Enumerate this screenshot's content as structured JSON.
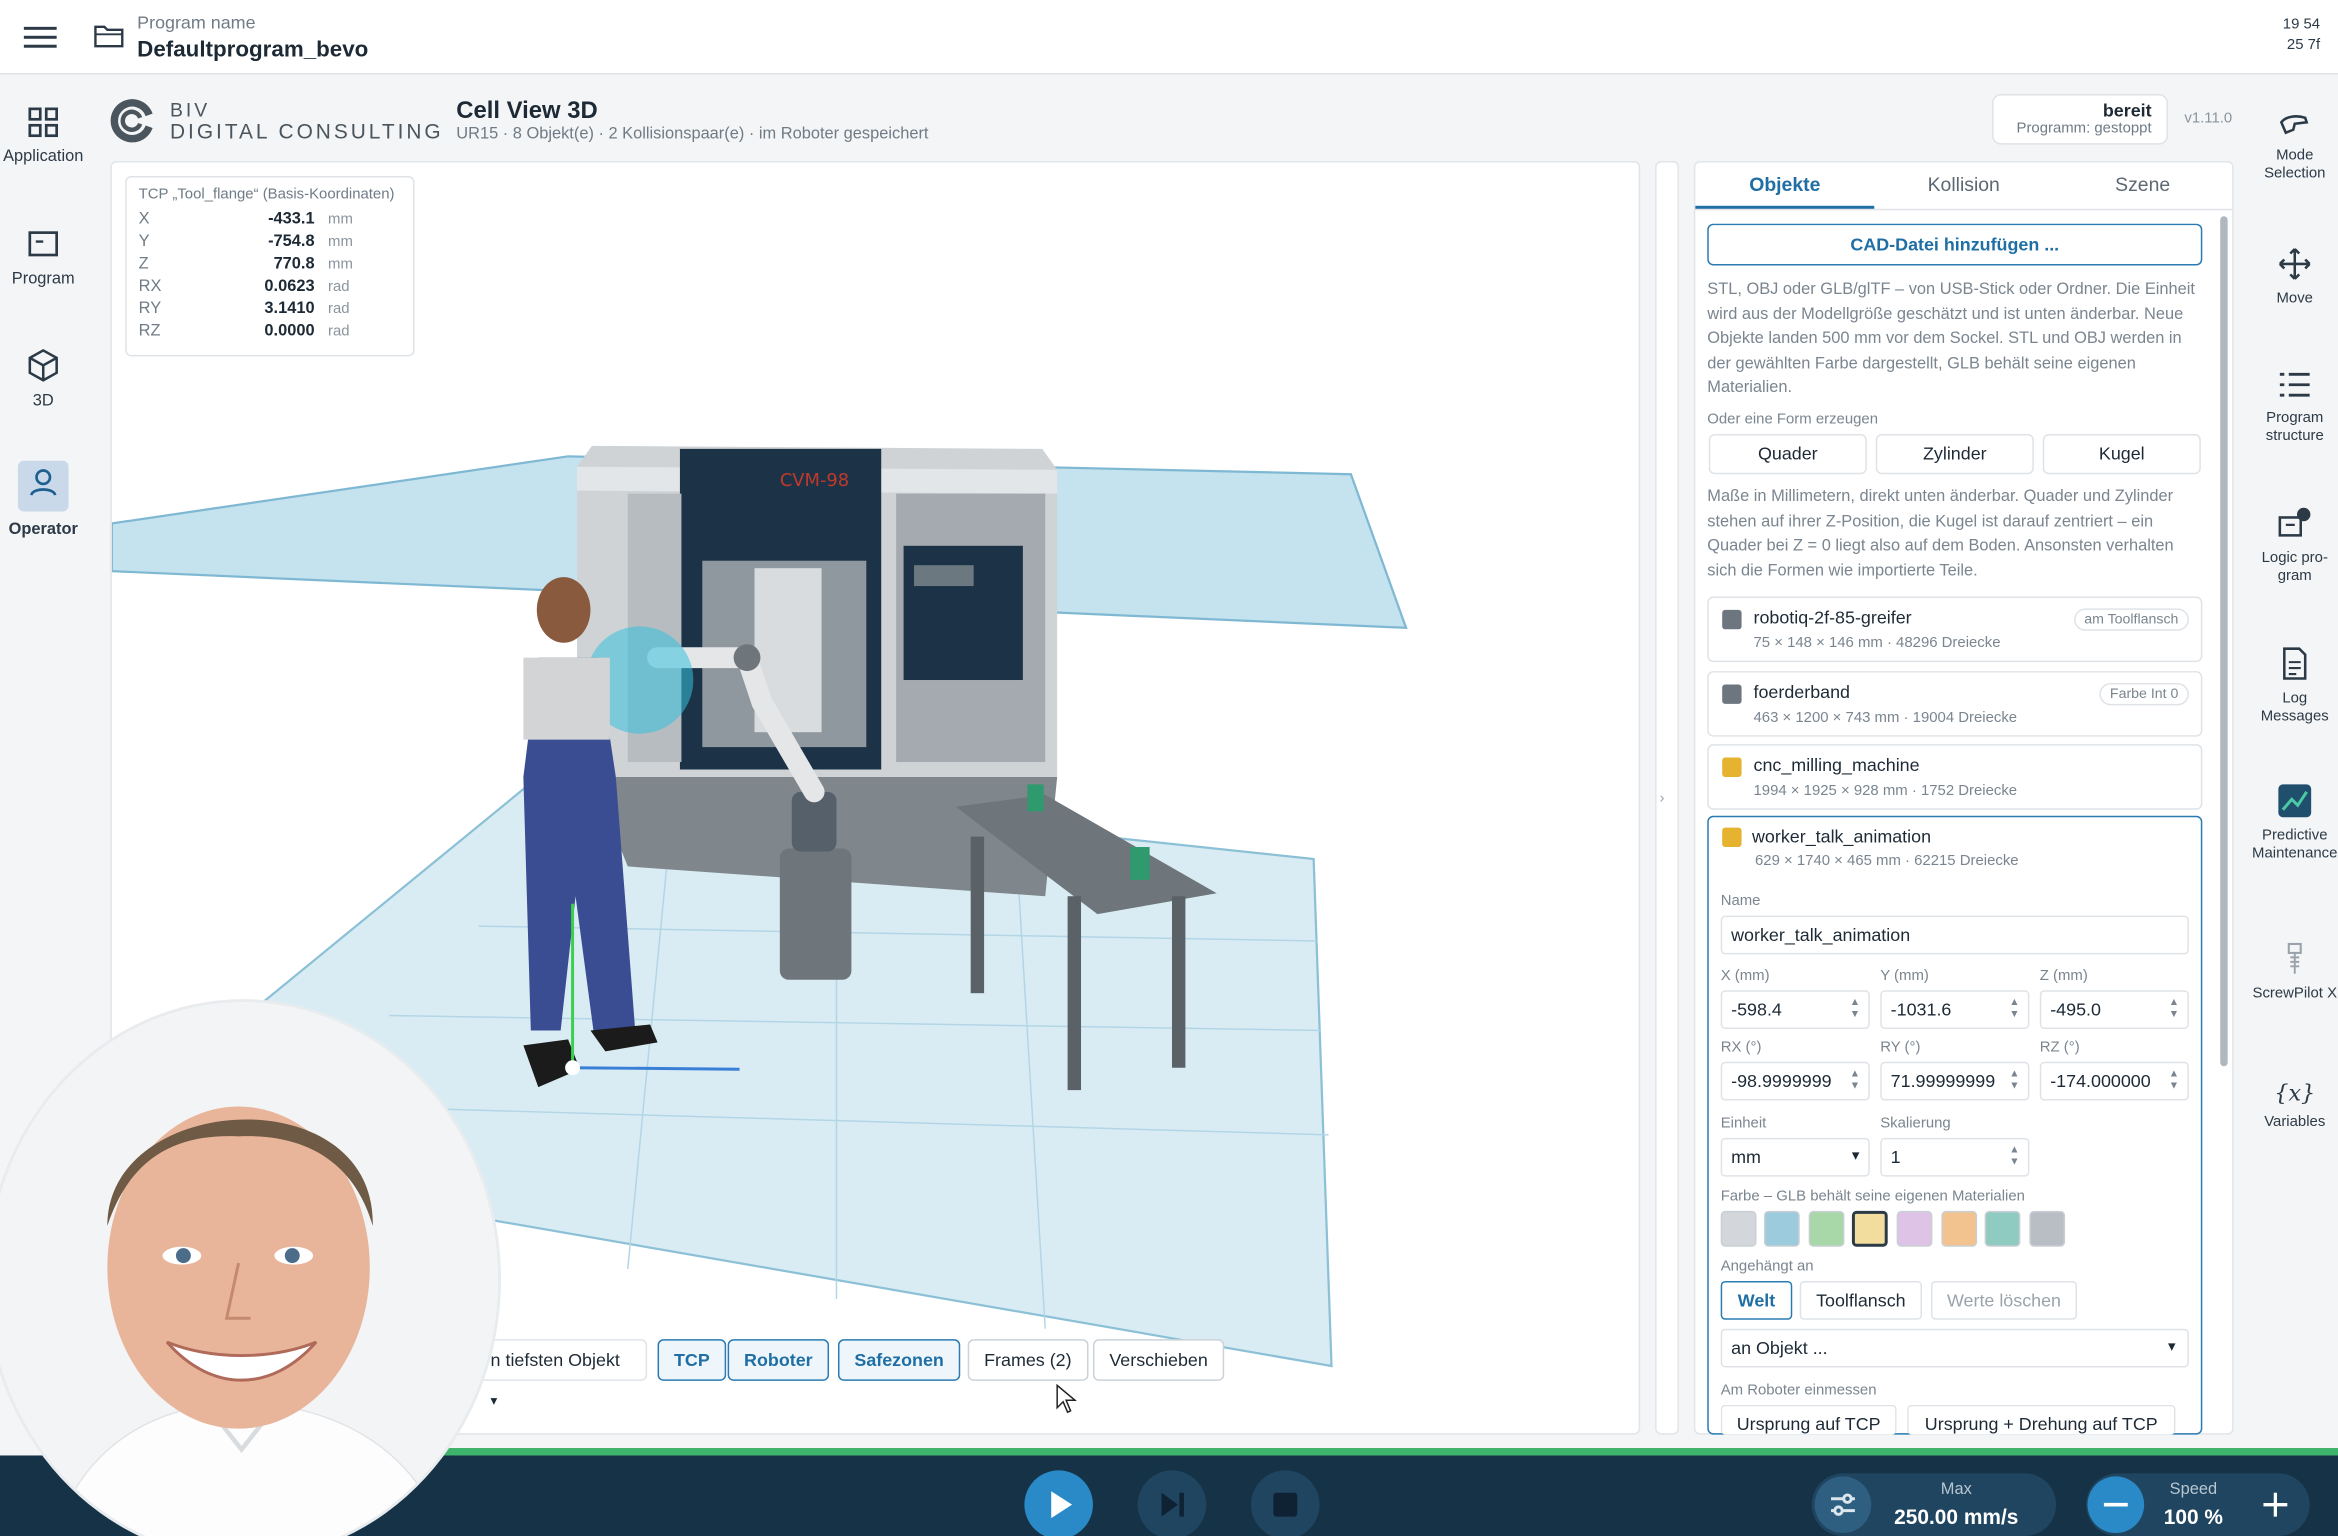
{
  "topbar": {
    "program_label": "Program name",
    "program_name": "Defaultprogram_bevo",
    "clock_line1": "19 54",
    "clock_line2": "25 7f"
  },
  "leftnav": {
    "items": [
      {
        "label": "Application",
        "icon": "grid-icon"
      },
      {
        "label": "Program",
        "icon": "program-icon"
      },
      {
        "label": "3D",
        "icon": "cube-icon"
      },
      {
        "label": "Operator",
        "icon": "user-icon"
      }
    ]
  },
  "rightnav": {
    "items": [
      {
        "label": "Mode Selection",
        "icon": "hand-icon"
      },
      {
        "label": "Move",
        "icon": "move-icon"
      },
      {
        "label": "Program structure",
        "icon": "list-icon"
      },
      {
        "label": "Logic pro-gram",
        "icon": "logic-icon"
      },
      {
        "label": "Log Messages",
        "icon": "log-icon"
      },
      {
        "label": "Predictive Maintenance",
        "icon": "chart-icon"
      },
      {
        "label": "ScrewPilot X",
        "icon": "screw-icon"
      },
      {
        "label": "Variables",
        "icon": "variables-icon"
      }
    ]
  },
  "header": {
    "logo_line1": "BIV",
    "logo_line2": "DIGITAL CONSULTING",
    "title": "Cell View 3D",
    "subtitle": "UR15 · 8 Objekt(e) · 2 Kollisionspaar(e) · im Roboter gespeichert",
    "status": "bereit",
    "status_sub": "Programm: gestoppt",
    "version": "v1.11.0"
  },
  "tcp": {
    "title": "TCP „Tool_flange“ (Basis-Koordinaten)",
    "rows": [
      {
        "k": "X",
        "v": "-433.1",
        "u": "mm"
      },
      {
        "k": "Y",
        "v": "-754.8",
        "u": "mm"
      },
      {
        "k": "Z",
        "v": "770.8",
        "u": "mm"
      },
      {
        "k": "RX",
        "v": "0.0623",
        "u": "rad"
      },
      {
        "k": "RY",
        "v": "3.1410",
        "u": "rad"
      },
      {
        "k": "RZ",
        "v": "0.0000",
        "u": "rad"
      }
    ]
  },
  "scene": {
    "machine_label": "CVM-98"
  },
  "viewtoolbar": {
    "select_value": "n tiefsten Objekt",
    "tcp": "TCP",
    "robot": "Roboter",
    "safezones": "Safezonen",
    "frames": "Frames (2)",
    "move": "Verschieben"
  },
  "panel": {
    "tabs": [
      "Objekte",
      "Kollision",
      "Szene"
    ],
    "cad_button": "CAD-Datei hinzufügen ...",
    "cad_info": "STL, OBJ oder GLB/glTF – von USB-Stick oder Ordner. Die Einheit wird aus der Modellgröße geschätzt und ist unten änderbar. Neue Objekte landen 500 mm vor dem Sockel. STL und OBJ werden in der gewählten Farbe dargestellt, GLB behält seine eigenen Materialien.",
    "shape_label": "Oder eine Form erzeugen",
    "shapes": [
      "Quader",
      "Zylinder",
      "Kugel"
    ],
    "shape_info": "Maße in Millimetern, direkt unten änderbar. Quader und Zylinder stehen auf ihrer Z-Position, die Kugel ist darauf zentriert – ein Quader bei Z = 0 liegt also auf dem Boden. Ansonsten verhalten sich die Formen wie importierte Teile.",
    "objects": [
      {
        "name": "robotiq-2f-85-greifer",
        "dims": "75 × 148 × 146 mm · 48296 Dreiecke",
        "tag": "am Toolflansch",
        "color": "#6d767e"
      },
      {
        "name": "foerderband",
        "dims": "463 × 1200 × 743 mm · 19004 Dreiecke",
        "tag": "Farbe Int 0",
        "color": "#6d767e"
      },
      {
        "name": "cnc_milling_machine",
        "dims": "1994 × 1925 × 928 mm · 1752 Dreiecke",
        "tag": "",
        "color": "#e6b330"
      },
      {
        "name": "worker_talk_animation",
        "dims": "629 × 1740 × 465 mm · 62215 Dreiecke",
        "tag": "",
        "color": "#e6b330"
      }
    ],
    "editor": {
      "name_label": "Name",
      "name_value": "worker_talk_animation",
      "x_label": "X (mm)",
      "x": "-598.4",
      "y_label": "Y (mm)",
      "y": "-1031.6",
      "z_label": "Z (mm)",
      "z": "-495.0",
      "rx_label": "RX (°)",
      "rx": "-98.9999999",
      "ry_label": "RY (°)",
      "ry": "71.99999999",
      "rz_label": "RZ (°)",
      "rz": "-174.000000",
      "unit_label": "Einheit",
      "unit": "mm",
      "scale_label": "Skalierung",
      "scale": "1",
      "color_label": "Farbe – GLB behält seine eigenen Materialien",
      "colors": [
        "#d3d6da",
        "#9ccbdd",
        "#a8d8a8",
        "#f3dd9e",
        "#dfc3e6",
        "#f2c28f",
        "#8fcbc0",
        "#b9bec5"
      ],
      "attached_label": "Angehängt an",
      "attach_world": "Welt",
      "attach_flange": "Toolflansch",
      "attach_clear": "Werte löschen",
      "attach_object": "an Objekt ...",
      "measure_label": "Am Roboter einmessen",
      "origin_tcp": "Ursprung auf TCP",
      "origin_rot_tcp": "Ursprung + Drehung auf TCP"
    }
  },
  "bottombar": {
    "max_label": "Max",
    "max_value": "250.00 mm/s",
    "speed_label": "Speed",
    "speed_value": "100 %"
  }
}
